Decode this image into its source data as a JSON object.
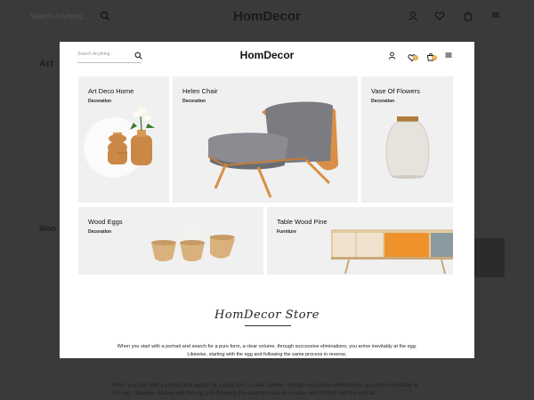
{
  "background": {
    "search_placeholder": "Search Anything...",
    "logo": "HomDecor",
    "left_heading_1": "Art",
    "left_heading_2": "Woo",
    "paragraph": "When you start with a portrait and search for a pure form, a clear volume, through successive eliminations, you arrive inevitably at the egg. Likewise, starting with the egg and following the same process in reverse, one finishes with the portrait."
  },
  "header": {
    "search_placeholder": "Search Anything...",
    "logo": "HomDecor",
    "wishlist_count": "0",
    "cart_count": "0"
  },
  "cards": [
    {
      "title": "Art Deco Home",
      "subtitle": "Decoration"
    },
    {
      "title": "Helen Chair",
      "subtitle": "Decoration"
    },
    {
      "title": "Vase Of Flowers",
      "subtitle": "Decoration"
    },
    {
      "title": "Wood Eggs",
      "subtitle": "Decoration"
    },
    {
      "title": "Table Wood Pine",
      "subtitle": "Furniture"
    }
  ],
  "store": {
    "logo_text": "HomDecor Store",
    "text": "When you start with a portrait and search for a pure form, a clear volume, through successive eliminations, you arrive inevitably at the egg. Likewise, starting with the egg and following the same process in reverse,"
  },
  "colors": {
    "accent": "#e8a54b",
    "card_bg": "#f0f0f0",
    "overlay": "#3a3a3a"
  },
  "icons": [
    "search-icon",
    "user-icon",
    "heart-icon",
    "cart-icon",
    "menu-icon"
  ]
}
